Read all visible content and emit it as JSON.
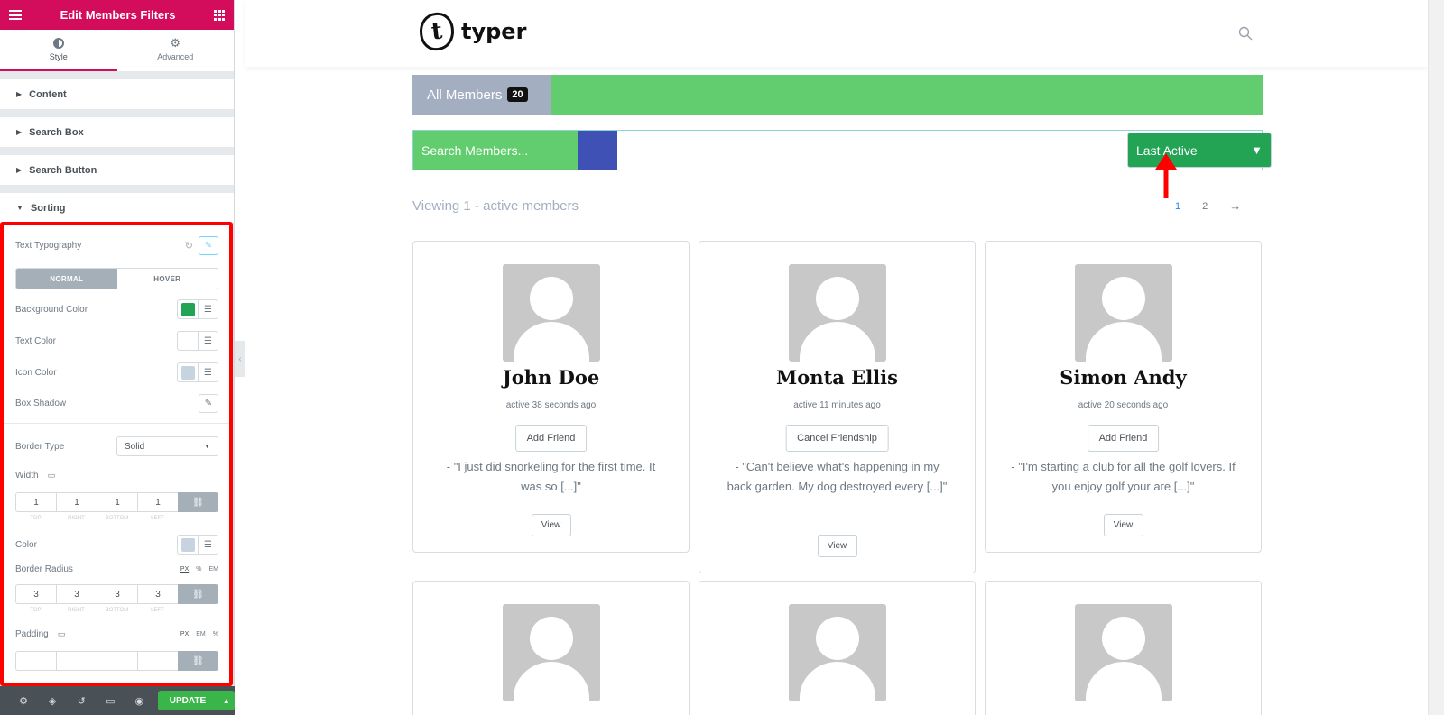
{
  "panel": {
    "title": "Edit Members Filters",
    "tabs": [
      {
        "label": "Style",
        "icon": "half-circle-icon",
        "active": true
      },
      {
        "label": "Advanced",
        "icon": "gear-icon",
        "active": false
      }
    ],
    "sections": [
      "Content",
      "Search Box",
      "Search Button",
      "Sorting"
    ],
    "sorting": {
      "text_typography": "Text Typography",
      "state_tabs": [
        "NORMAL",
        "HOVER"
      ],
      "background_color_label": "Background Color",
      "background_color": "#23a455",
      "text_color_label": "Text Color",
      "text_color": "#ffffff",
      "icon_color_label": "Icon Color",
      "icon_color": "#c8d3e0",
      "box_shadow_label": "Box Shadow",
      "border_type_label": "Border Type",
      "border_type_value": "Solid",
      "width_label": "Width",
      "width_values": [
        "1",
        "1",
        "1",
        "1"
      ],
      "dim_labels": [
        "TOP",
        "RIGHT",
        "BOTTOM",
        "LEFT"
      ],
      "color_label": "Color",
      "color_value": "#c8d3e0",
      "border_radius_label": "Border Radius",
      "border_radius_units": [
        "PX",
        "%",
        "EM"
      ],
      "border_radius_values": [
        "3",
        "3",
        "3",
        "3"
      ],
      "padding_label": "Padding",
      "padding_units": [
        "PX",
        "EM",
        "%"
      ],
      "padding_values": [
        "",
        "",
        "",
        ""
      ]
    },
    "footer": {
      "update_label": "UPDATE"
    }
  },
  "site": {
    "logo_text": "typer",
    "logo_mark": "t",
    "members_tab_label": "All Members",
    "members_count": "20",
    "search_placeholder": "Search Members...",
    "sort_value": "Last Active",
    "viewing_text": "Viewing 1 - active members",
    "pagination": [
      "1",
      "2",
      "→"
    ],
    "members": [
      {
        "name": "John Doe",
        "active": "active 38 seconds ago",
        "button": "Add Friend",
        "quote": "- \"I just did snorkeling for the first time. It was so [...]\"",
        "view": "View"
      },
      {
        "name": "Monta Ellis",
        "active": "active 11 minutes ago",
        "button": "Cancel Friendship",
        "quote": "- \"Can't believe what's happening in my back garden. My dog destroyed every [...]\"",
        "view": "View"
      },
      {
        "name": "Simon Andy",
        "active": "active 20 seconds ago",
        "button": "Add Friend",
        "quote": "- \"I'm starting a club for all the golf lovers. If you enjoy golf your are [...]\"",
        "view": "View"
      }
    ]
  }
}
